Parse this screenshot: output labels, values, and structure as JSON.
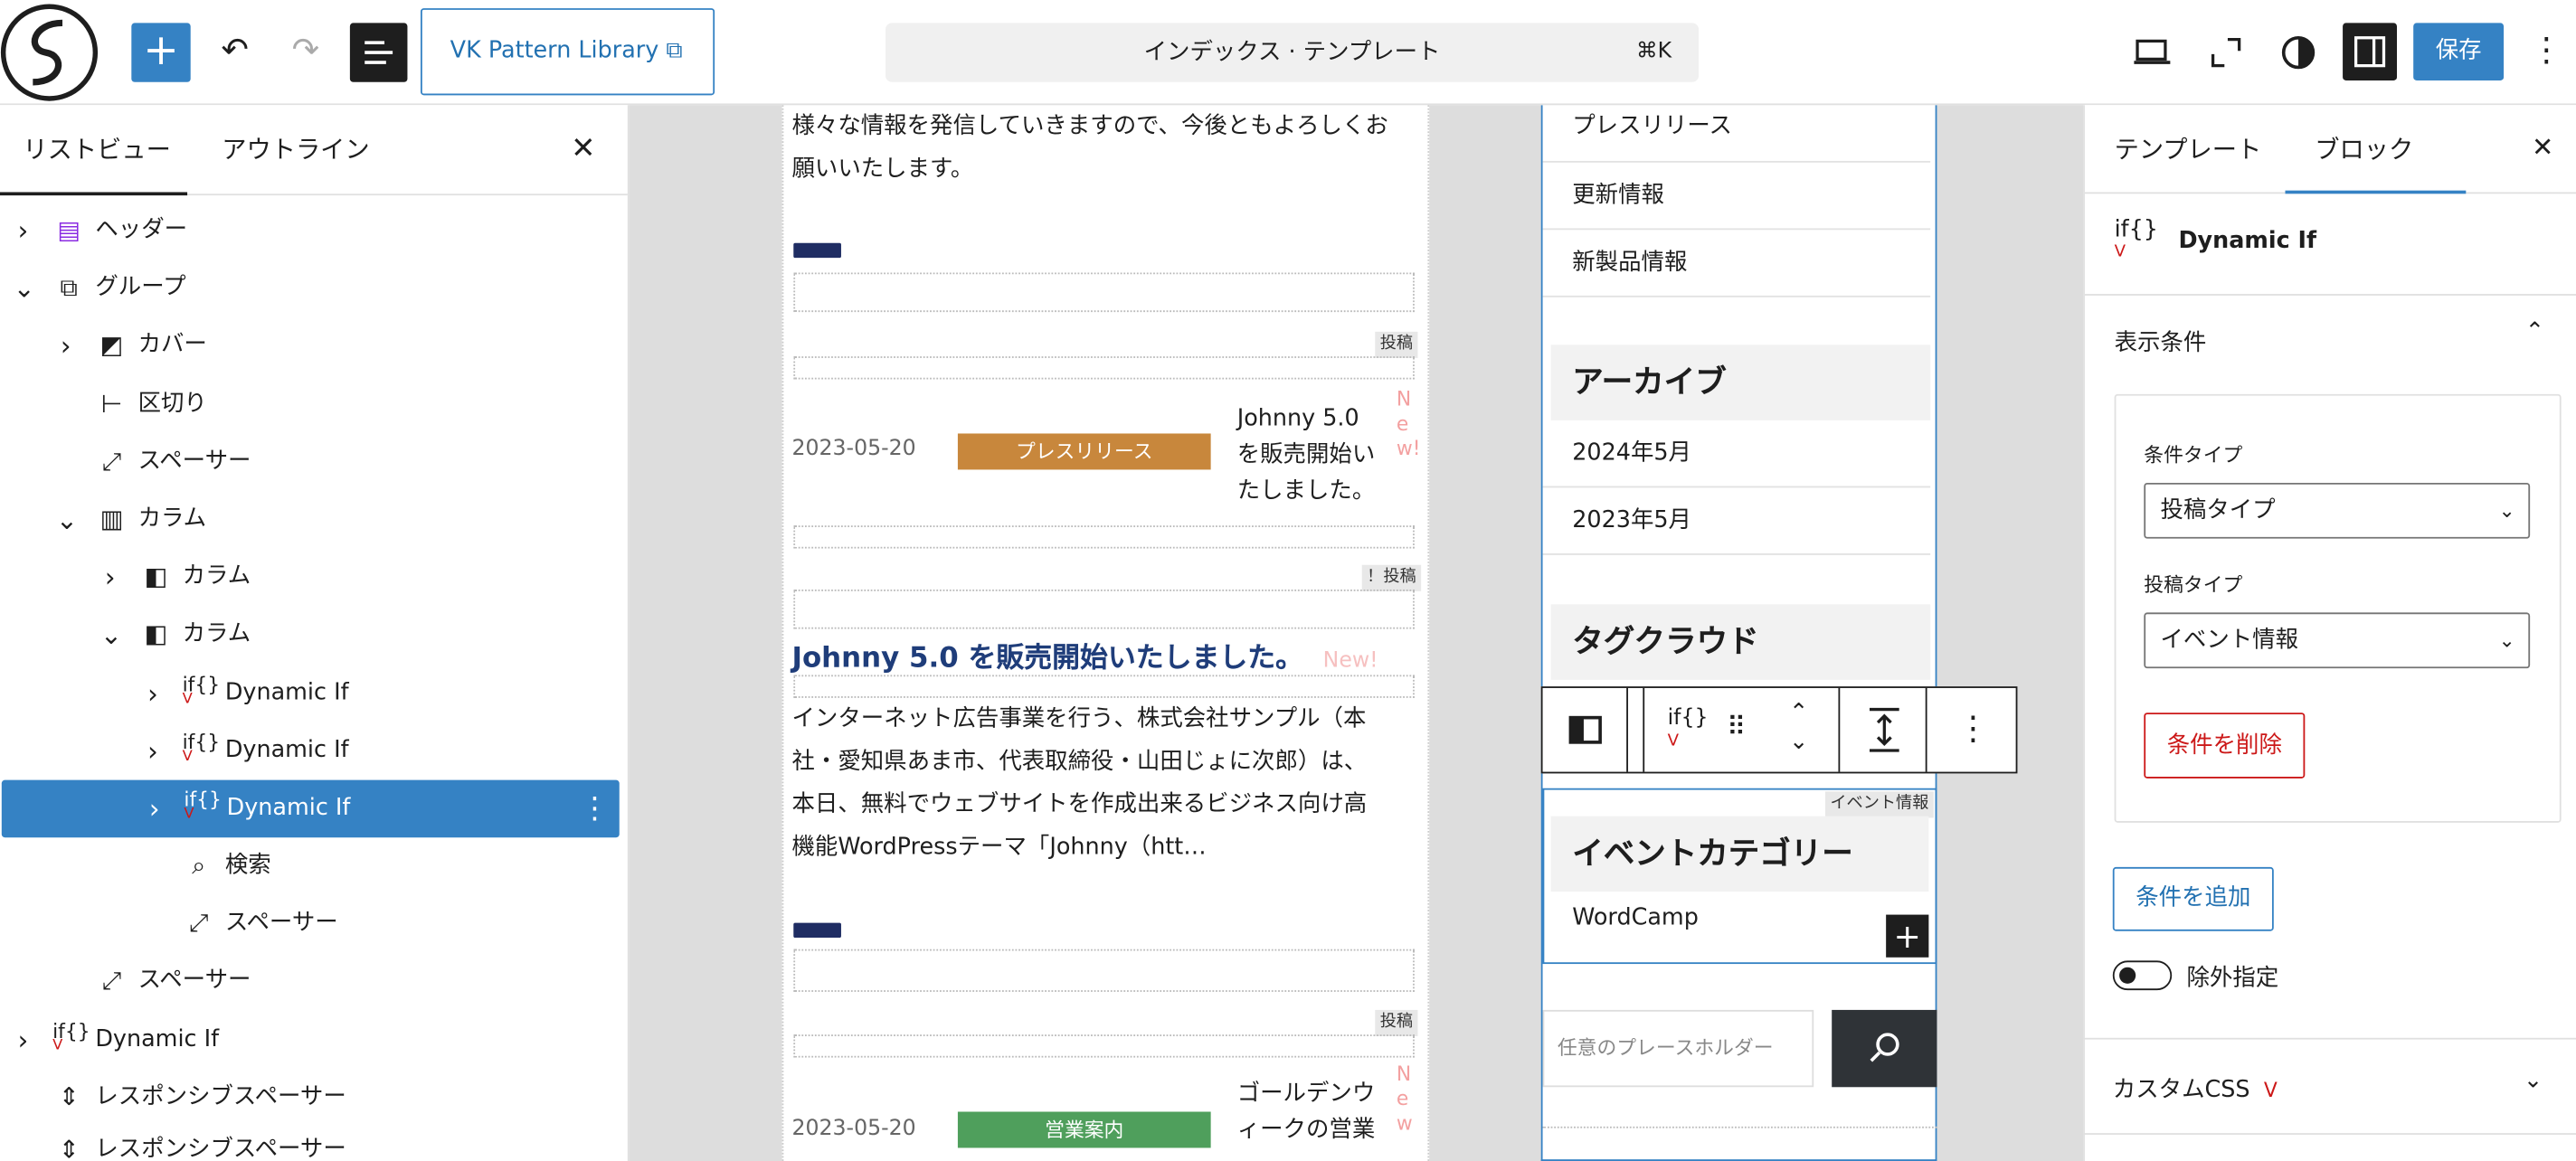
{
  "header": {
    "pattern_library_label": "VK Pattern Library",
    "command_title": "インデックス · テンプレート",
    "command_shortcut": "⌘K",
    "save_label": "保存"
  },
  "left_panel": {
    "tabs": [
      "リストビュー",
      "アウトライン"
    ],
    "items": [
      {
        "label": "ヘッダー",
        "icon": "header-icon"
      },
      {
        "label": "グループ",
        "icon": "group-icon"
      },
      {
        "label": "カバー",
        "icon": "cover-icon"
      },
      {
        "label": "区切り",
        "icon": "separator-icon"
      },
      {
        "label": "スペーサー",
        "icon": "spacer-icon"
      },
      {
        "label": "カラム",
        "icon": "columns-icon"
      },
      {
        "label": "カラム",
        "icon": "column-icon"
      },
      {
        "label": "カラム",
        "icon": "column-icon"
      },
      {
        "label": "Dynamic If",
        "icon": "dynamic-if-icon"
      },
      {
        "label": "Dynamic If",
        "icon": "dynamic-if-icon"
      },
      {
        "label": "Dynamic If",
        "icon": "dynamic-if-icon"
      },
      {
        "label": "検索",
        "icon": "search-icon"
      },
      {
        "label": "スペーサー",
        "icon": "spacer-icon"
      },
      {
        "label": "スペーサー",
        "icon": "spacer-icon"
      },
      {
        "label": "Dynamic If",
        "icon": "dynamic-if-icon"
      },
      {
        "label": "レスポンシブスペーサー",
        "icon": "responsive-spacer-icon"
      },
      {
        "label": "レスポンシブスペーサー",
        "icon": "responsive-spacer-icon"
      }
    ]
  },
  "canvas": {
    "intro_text_1": "様々な情報を発信していきますので、今後ともよろしくお",
    "intro_text_2": "願いいたします。",
    "post_tag_1": "投稿",
    "post1": {
      "date": "2023-05-20",
      "category": "プレスリリース",
      "title_lines": [
        "Johnny 5.0",
        "を販売開始い",
        "たしました。"
      ],
      "new": "New!"
    },
    "post_tag_2": "！投稿",
    "feature_title": "Johnny 5.0 を販売開始いたしました。",
    "feature_new": "New!",
    "feature_excerpt": [
      "インターネット広告事業を行う、株式会社サンプル（本",
      "社・愛知県あま市、代表取締役・山田じょに次郎）は、",
      "本日、無料でウェブサイトを作成出来るビジネス向け高",
      "機能WordPressテーマ「Johnny（htt…"
    ],
    "post_tag_3": "投稿",
    "post2": {
      "date": "2023-05-20",
      "category": "営業案内",
      "title_lines": [
        "ゴールデンウ",
        "ィークの営業"
      ],
      "new": "New"
    },
    "sidebar": {
      "categories": [
        "プレスリリース",
        "更新情報",
        "新製品情報"
      ],
      "archive_heading": "アーカイブ",
      "archives": [
        "2024年5月",
        "2023年5月"
      ],
      "tagcloud_heading": "タグクラウド",
      "event_tag": "イベント情報",
      "event_heading": "イベントカテゴリー",
      "event_item": "WordCamp",
      "search_placeholder": "任意のプレースホルダー"
    }
  },
  "right_panel": {
    "tabs": [
      "テンプレート",
      "ブロック"
    ],
    "block_name": "Dynamic If",
    "section_title": "表示条件",
    "condition_type_label": "条件タイプ",
    "condition_type_value": "投稿タイプ",
    "post_type_label": "投稿タイプ",
    "post_type_value": "イベント情報",
    "delete_label": "条件を削除",
    "add_label": "条件を追加",
    "exclude_label": "除外指定",
    "custom_css_label": "カスタムCSS"
  },
  "colors": {
    "accent": "#3582c4",
    "press_release": "#c8873c",
    "sales": "#4f9f5c",
    "navy": "#1f2d63"
  }
}
